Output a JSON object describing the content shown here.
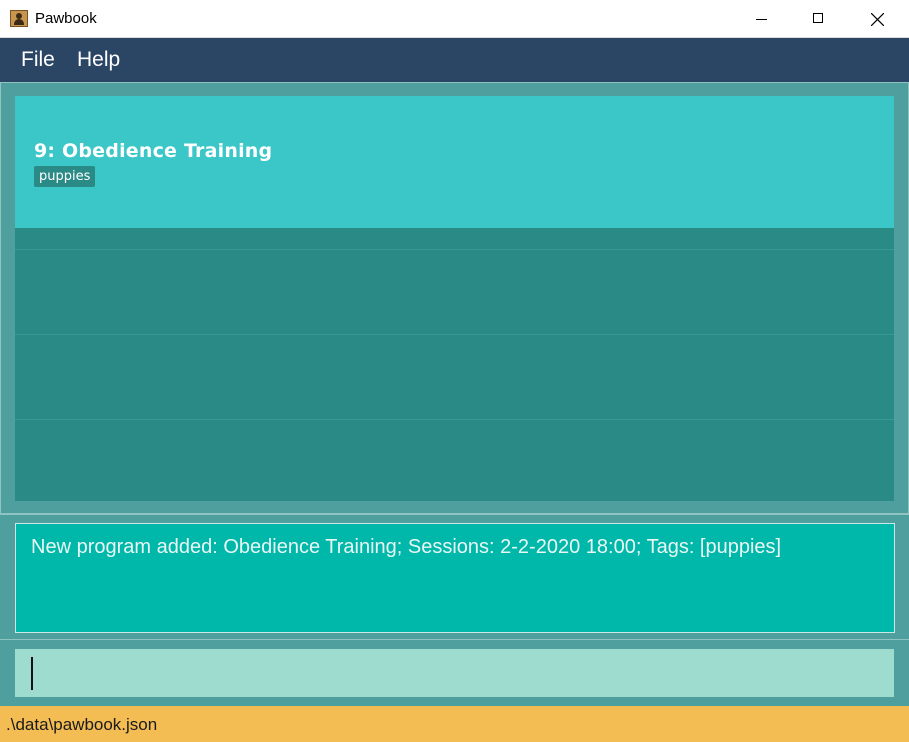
{
  "window": {
    "title": "Pawbook",
    "icon": "app-icon"
  },
  "menu": {
    "file_label": "File",
    "help_label": "Help"
  },
  "list": {
    "items": [
      {
        "title": "9:  Obedience Training",
        "tags": [
          "puppies"
        ]
      }
    ]
  },
  "result": {
    "message": "New program added: Obedience Training; Sessions: 2-2-2020 18:00; Tags: [puppies]"
  },
  "command": {
    "value": ""
  },
  "status": {
    "file_path": ".\\data\\pawbook.json"
  },
  "colors": {
    "menubar": "#2b4565",
    "card": "#3bc6c8",
    "list_bg": "#2a8a86",
    "result_bg": "#00b8aa",
    "command_bg": "#9edcd0",
    "statusbar": "#f4bd54"
  }
}
